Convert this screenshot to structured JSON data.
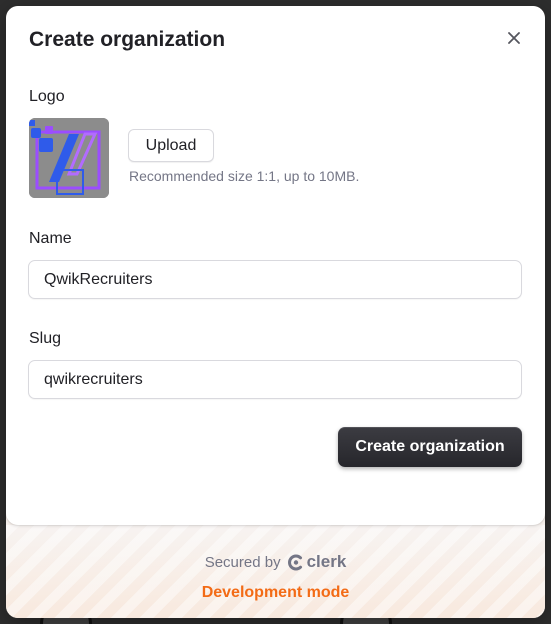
{
  "dialog": {
    "title": "Create organization"
  },
  "logo": {
    "label": "Logo",
    "upload_label": "Upload",
    "hint": "Recommended size 1:1, up to 10MB."
  },
  "name_field": {
    "label": "Name",
    "value": "QwikRecruiters"
  },
  "slug_field": {
    "label": "Slug",
    "value": "qwikrecruiters"
  },
  "submit_label": "Create organization",
  "footer": {
    "secured_by": "Secured by",
    "brand": "clerk",
    "dev_mode": "Development mode"
  },
  "colors": {
    "primary_button": "#2f2f34",
    "dev_mode": "#f36b16",
    "muted_text": "#747686",
    "logo_accent_blue": "#2f5bea",
    "logo_accent_purple": "#9b4dff"
  },
  "icons": {
    "close": "close-icon",
    "brand": "clerk-logo-icon"
  }
}
